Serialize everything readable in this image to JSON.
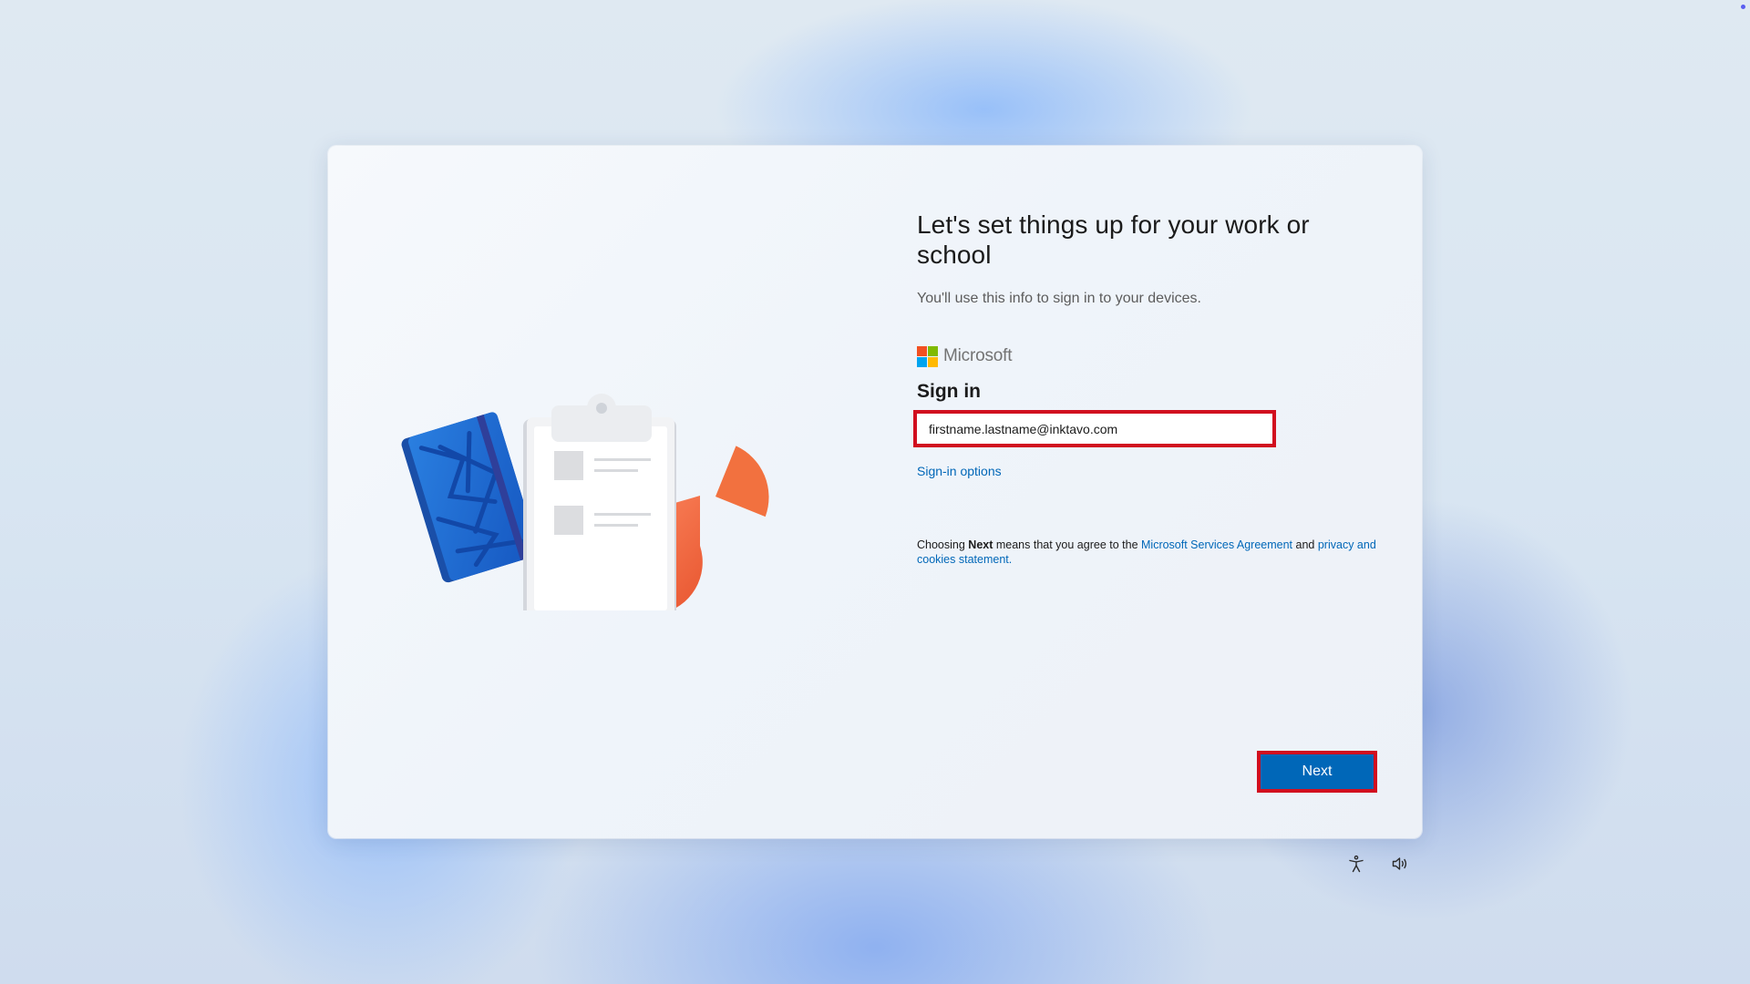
{
  "setup": {
    "title": "Let's set things up for your work or school",
    "subtitle": "You'll use this info to sign in to your devices.",
    "brand": {
      "name": "Microsoft",
      "logo_colors": [
        "#f25022",
        "#7fba00",
        "#00a4ef",
        "#ffb900"
      ]
    },
    "signin_heading": "Sign in",
    "email_value": "firstname.lastname@inktavo.com",
    "signin_options_label": "Sign-in options",
    "agreement": {
      "prefix": "Choosing ",
      "bold": "Next",
      "middle": " means that you agree to the ",
      "msa_link": "Microsoft Services Agreement",
      "and": " and ",
      "privacy_link": "privacy and cookies statement",
      "suffix": "."
    },
    "next_label": "Next"
  },
  "footer_icons": [
    "accessibility-icon",
    "volume-icon"
  ],
  "colors": {
    "accent": "#0067b8",
    "highlight": "#d10f1f"
  }
}
